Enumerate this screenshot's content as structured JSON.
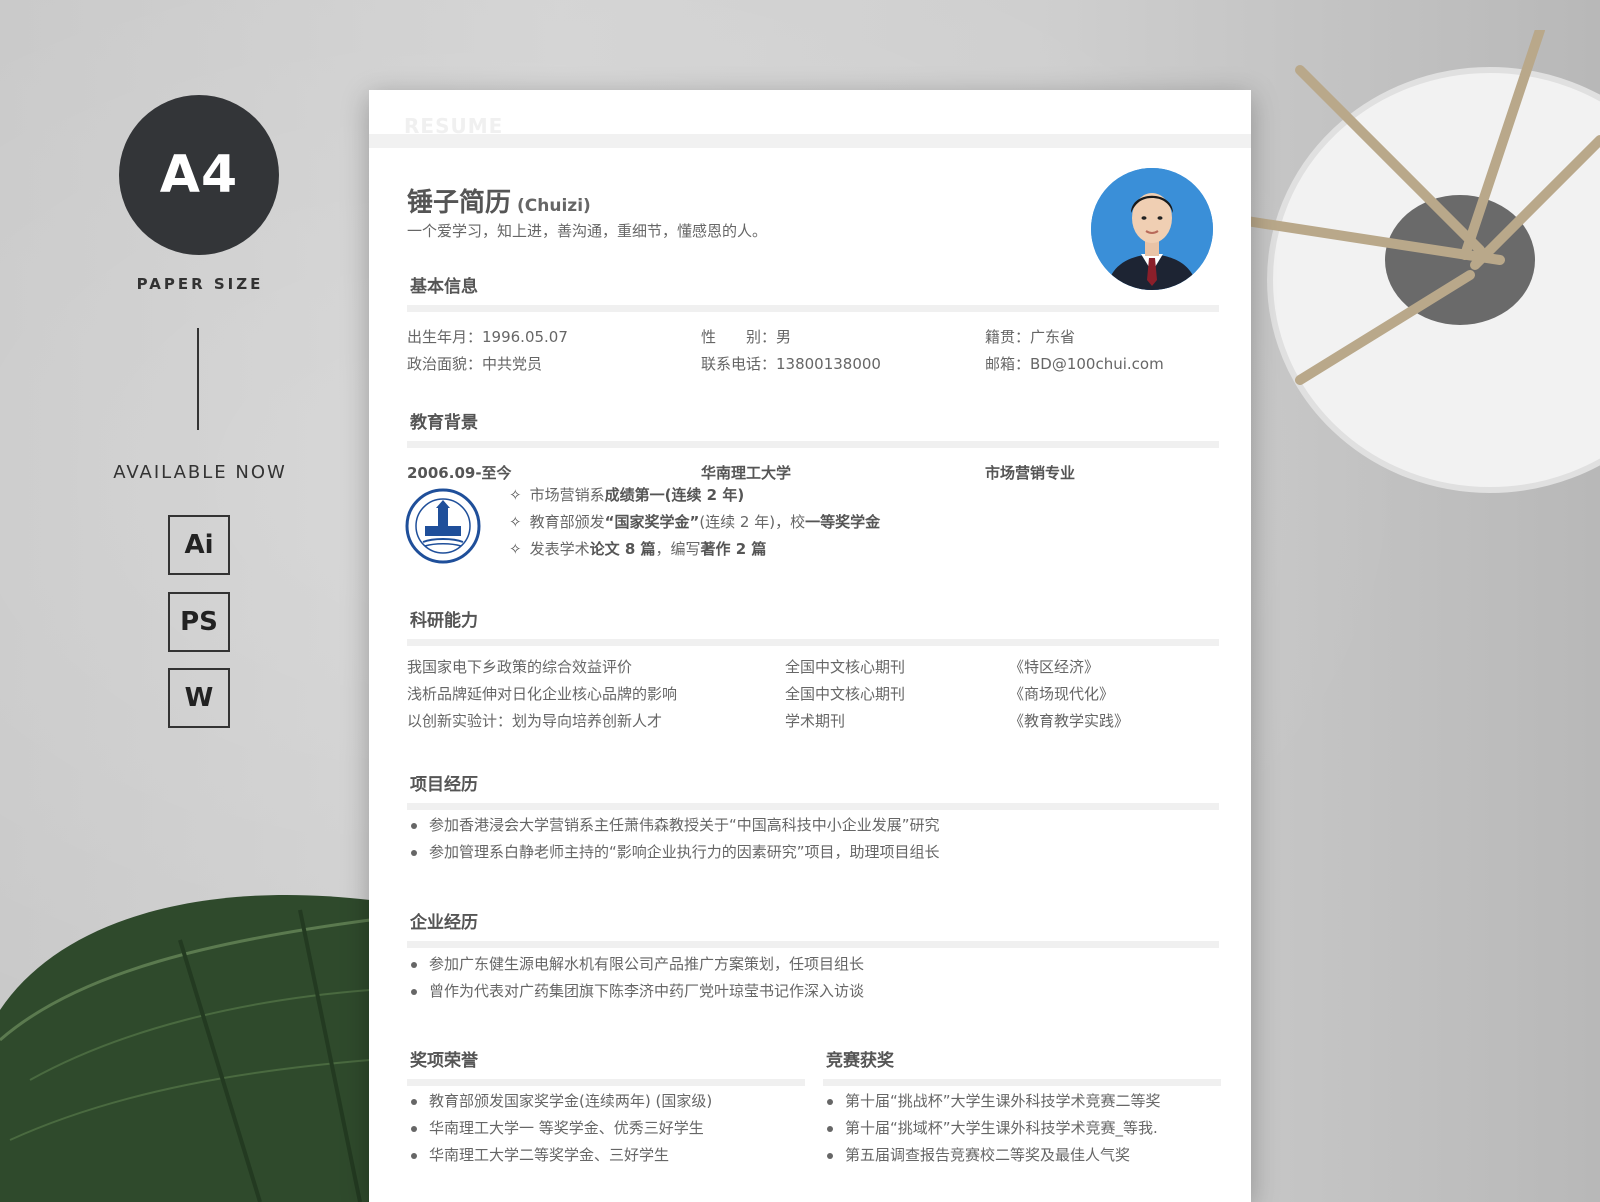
{
  "promo": {
    "paper_label": "A4",
    "paper_size_text": "PAPER SIZE",
    "available_text": "AVAILABLE NOW",
    "formats": [
      "Ai",
      "PS",
      "W"
    ]
  },
  "resume": {
    "watermark": "RESUME",
    "name": "锤子简历",
    "name_en": "(Chuizi)",
    "motto": "一个爱学习，知上进，善沟通，重细节，懂感恩的人。",
    "basic": {
      "title": "基本信息",
      "birth": "出生年月：1996.05.07",
      "gender": "性　　别：男",
      "native": "籍贯：广东省",
      "politics": "政治面貌：中共党员",
      "phone": "联系电话：13800138000",
      "email": "邮箱：BD@100chui.com"
    },
    "education": {
      "title": "教育背景",
      "period": "2006.09-至今",
      "school": "华南理工大学",
      "major": "市场营销专业",
      "star": "✧",
      "items": [
        {
          "a": "市场营销系",
          "b": "成绩第一(连续 2 年)",
          "c": "",
          "d": ""
        },
        {
          "a": "教育部颁发",
          "b": "“国家奖学金”",
          "c": "(连续 2 年)，校",
          "d": "一等奖学金"
        },
        {
          "a": "发表学术",
          "b": "论文 8 篇",
          "c": "，编写",
          "d": "著作 2 篇"
        }
      ]
    },
    "research": {
      "title": "科研能力",
      "rows": [
        {
          "paper": "我国家电下乡政策的综合效益评价",
          "level": "全国中文核心期刊",
          "journal": "《特区经济》"
        },
        {
          "paper": "浅析品牌延伸对日化企业核心品牌的影响",
          "level": "全国中文核心期刊",
          "journal": "《商场现代化》"
        },
        {
          "paper": "以创新实验计：划为导向培养创新人才",
          "level": "学术期刊",
          "journal": "《教育教学实践》"
        }
      ]
    },
    "projects": {
      "title": "项目经历",
      "items": [
        "参加香港浸会大学营销系主任萧伟森教授关于“中国高科技中小企业发展”研究",
        "参加管理系白静老师主持的“影响企业执行力的因素研究”项目，助理项目组长"
      ]
    },
    "enterprise": {
      "title": "企业经历",
      "items": [
        "参加广东健生源电解水机有限公司产品推广方案策划，任项目组长",
        "曾作为代表对广药集团旗下陈李济中药厂党叶琼莹书记作深入访谈"
      ]
    },
    "honors": {
      "title": "奖项荣誉",
      "items": [
        "教育部颁发国家奖学金(连续两年) (国家级)",
        "华南理工大学一 等奖学金、优秀三好学生",
        "华南理工大学二等奖学金、三好学生"
      ]
    },
    "competitions": {
      "title": "竞赛获奖",
      "items": [
        "第十届“挑战杯”大学生课外科技学术竞赛二等奖",
        "第十届“挑域杯”大学生课外科技学术竞赛_等我.",
        "第五届调查报告竞赛校二等奖及最佳人气奖"
      ]
    }
  },
  "colors": {
    "photo_bg": "#3a8fd8",
    "seal_blue": "#1f4f9a",
    "dark_circle": "#333538"
  }
}
